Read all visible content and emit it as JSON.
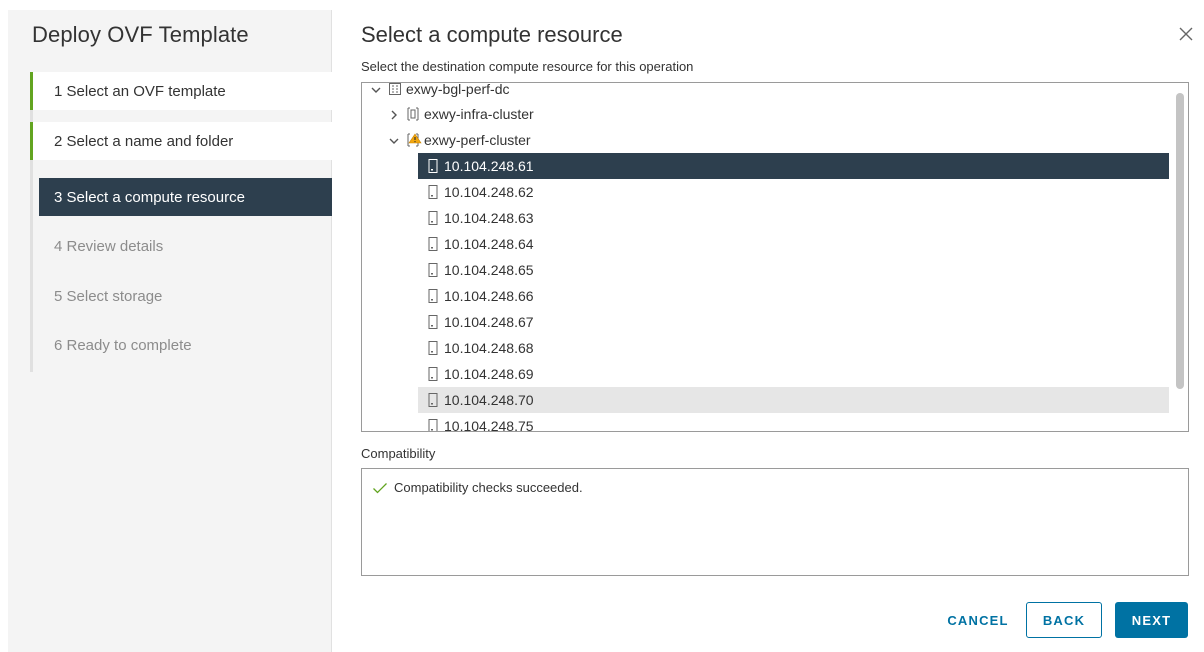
{
  "wizard": {
    "title": "Deploy OVF Template",
    "steps": [
      {
        "label": "1  Select an OVF template",
        "state": "done"
      },
      {
        "label": "2  Select a name and folder",
        "state": "done"
      },
      {
        "label": "3  Select a compute resource",
        "state": "active"
      },
      {
        "label": "4  Review details",
        "state": "pending"
      },
      {
        "label": "5  Select storage",
        "state": "pending"
      },
      {
        "label": "6  Ready to complete",
        "state": "pending"
      }
    ]
  },
  "page": {
    "title": "Select a compute resource",
    "subtitle": "Select the destination compute resource for this operation",
    "close_icon": "close-icon"
  },
  "tree": {
    "datacenter": {
      "label": "exwy-bgl-perf-dc",
      "expanded": true,
      "icon": "datacenter-icon"
    },
    "clusters": [
      {
        "label": "exwy-infra-cluster",
        "expanded": false,
        "icon": "cluster-icon"
      },
      {
        "label": "exwy-perf-cluster",
        "expanded": true,
        "icon": "cluster-warning-icon"
      }
    ],
    "hosts": [
      {
        "label": "10.104.248.61",
        "state": "selected"
      },
      {
        "label": "10.104.248.62",
        "state": ""
      },
      {
        "label": "10.104.248.63",
        "state": ""
      },
      {
        "label": "10.104.248.64",
        "state": ""
      },
      {
        "label": "10.104.248.65",
        "state": ""
      },
      {
        "label": "10.104.248.66",
        "state": ""
      },
      {
        "label": "10.104.248.67",
        "state": ""
      },
      {
        "label": "10.104.248.68",
        "state": ""
      },
      {
        "label": "10.104.248.69",
        "state": ""
      },
      {
        "label": "10.104.248.70",
        "state": "hover"
      },
      {
        "label": "10.104.248.75",
        "state": ""
      }
    ]
  },
  "compatibility": {
    "label": "Compatibility",
    "message": "Compatibility checks succeeded.",
    "status_color": "#62a420"
  },
  "buttons": {
    "cancel": "CANCEL",
    "back": "BACK",
    "next": "NEXT"
  },
  "colors": {
    "accent": "#0072a3",
    "selected_bg": "#2d3f4e",
    "done_marker": "#62a420",
    "warning": "#f2a60d"
  }
}
